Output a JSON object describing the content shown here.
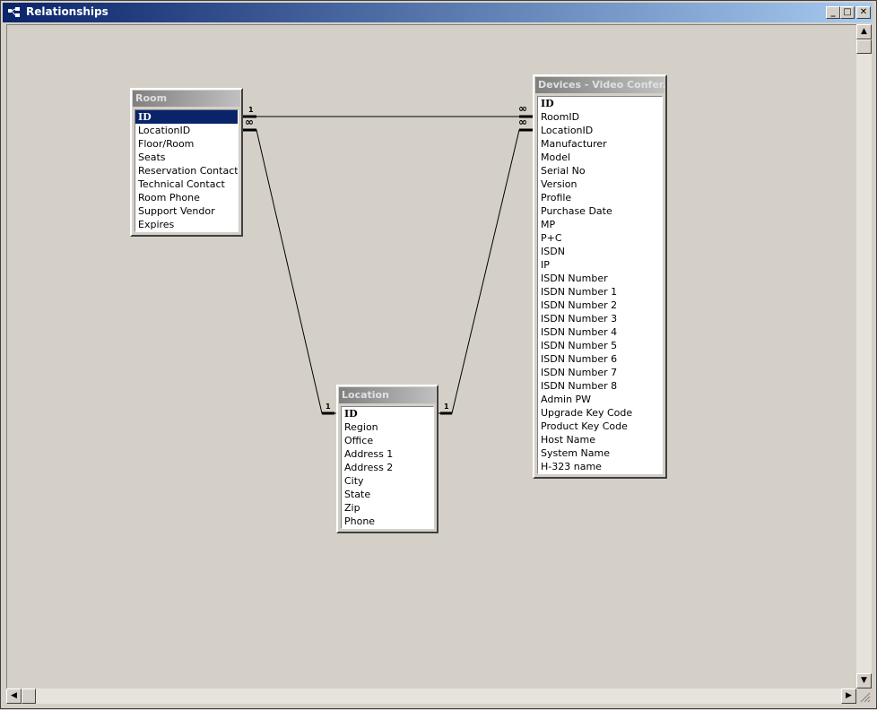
{
  "window": {
    "title": "Relationships",
    "controls": {
      "minimize": "_",
      "maximize": "□",
      "close": "✕"
    }
  },
  "tables": {
    "room": {
      "title": "Room",
      "fields": [
        "ID",
        "LocationID",
        "Floor/Room",
        "Seats",
        "Reservation Contact",
        "Technical Contact",
        "Room Phone",
        "Support Vendor",
        "Expires"
      ]
    },
    "devices": {
      "title": "Devices - Video Confer...",
      "fields": [
        "ID",
        "RoomID",
        "LocationID",
        "Manufacturer",
        "Model",
        "Serial No",
        "Version",
        "Profile",
        "Purchase Date",
        "MP",
        "P+C",
        "ISDN",
        "IP",
        "ISDN Number",
        "ISDN Number 1",
        "ISDN Number 2",
        "ISDN Number 3",
        "ISDN Number 4",
        "ISDN Number 5",
        "ISDN Number 6",
        "ISDN Number 7",
        "ISDN Number 8",
        "Admin PW",
        "Upgrade Key Code",
        "Product Key Code",
        "Host Name",
        "System Name",
        "H-323 name"
      ]
    },
    "location": {
      "title": "Location",
      "fields": [
        "ID",
        "Region",
        "Office",
        "Address 1",
        "Address 2",
        "City",
        "State",
        "Zip",
        "Phone"
      ]
    }
  },
  "relationships": [
    {
      "from": "Room.ID",
      "to": "Devices.RoomID",
      "from_label": "1",
      "to_label": "∞"
    },
    {
      "from": "Location.ID",
      "to": "Room.LocationID",
      "from_label": "1",
      "to_label": "∞"
    },
    {
      "from": "Location.ID",
      "to": "Devices.LocationID",
      "from_label": "1",
      "to_label": "∞"
    }
  ],
  "scrollbars": {
    "up": "▲",
    "down": "▼",
    "left": "◀",
    "right": "▶"
  },
  "colors": {
    "titlebar_start": "#0a246a",
    "titlebar_end": "#a6caf0",
    "selection": "#0a246a",
    "canvas": "#d4d0c8"
  }
}
